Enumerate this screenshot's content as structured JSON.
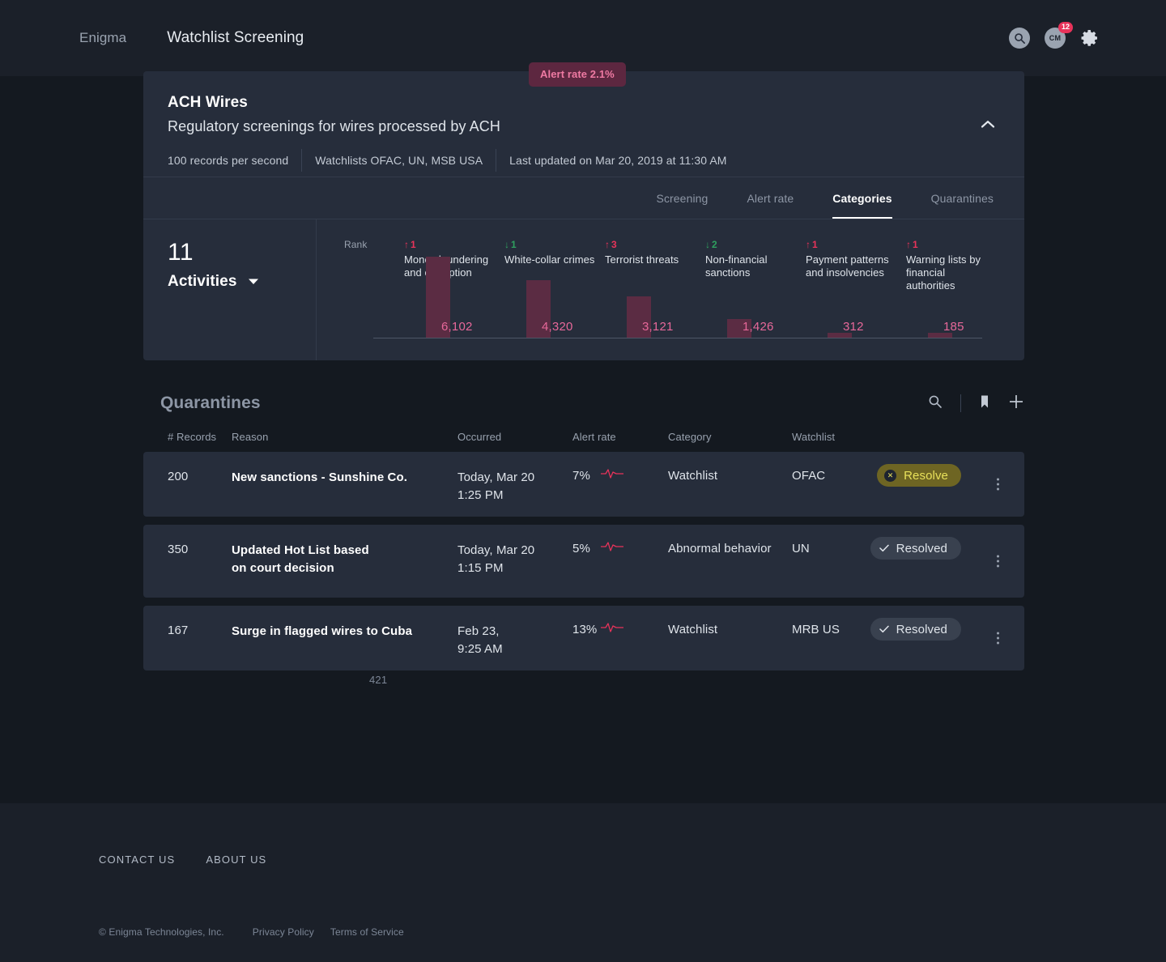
{
  "nav": {
    "brand": "Enigma",
    "title": "Watchlist Screening",
    "search_icon": "search-icon",
    "avatar_initials": "CM",
    "badge_count": "12",
    "gear_icon": "gear-icon"
  },
  "alert_pill": {
    "label": "Alert rate 2.1%"
  },
  "card": {
    "title": "ACH Wires",
    "subtitle": "Regulatory screenings for wires processed by ACH",
    "collapse_icon": "chevron-up-icon",
    "meta": [
      "100 records per second",
      "Watchlists OFAC, UN, MSB USA",
      "Last updated on Mar 20, 2019 at 11:30 AM"
    ],
    "tabs": [
      {
        "label": "Screening",
        "active": false
      },
      {
        "label": "Alert rate",
        "active": false
      },
      {
        "label": "Categories",
        "active": true
      },
      {
        "label": "Quarantines",
        "active": false
      }
    ],
    "summary": {
      "count": "11",
      "label": "Activities",
      "caret_icon": "caret-down-icon"
    }
  },
  "chart_data": {
    "type": "bar",
    "title": "Categories",
    "rank_label": "Rank",
    "xlabel": "",
    "ylabel": "",
    "ylim": [
      0,
      6102
    ],
    "grid": false,
    "legend": "none",
    "categories": [
      "Money laundering and corruption",
      "White-collar crimes",
      "Terrorist threats",
      "Non-financial sanctions",
      "Payment patterns and insolvencies",
      "Warning lists by financial authorities"
    ],
    "values": [
      6102,
      4320,
      3121,
      1426,
      312,
      185
    ],
    "value_labels": [
      "6,102",
      "4,320",
      "3,121",
      "1,426",
      "312",
      "185"
    ],
    "rank_deltas": [
      {
        "direction": "up",
        "value": "1"
      },
      {
        "direction": "down",
        "value": "1"
      },
      {
        "direction": "up",
        "value": "3"
      },
      {
        "direction": "down",
        "value": "2"
      },
      {
        "direction": "up",
        "value": "1"
      },
      {
        "direction": "up",
        "value": "1"
      }
    ],
    "bar_color": "#5b2c43",
    "label_color": "#e8689a",
    "up_color": "#e8335a",
    "down_color": "#2fa05f"
  },
  "quarantines": {
    "title": "Quarantines",
    "actions": {
      "search_icon": "search-icon",
      "bookmark_icon": "bookmark-icon",
      "add_icon": "plus-icon"
    },
    "columns": [
      "# Records",
      "Reason",
      "Occurred",
      "Alert rate",
      "Category",
      "Watchlist"
    ],
    "rows": [
      {
        "records": "200",
        "reason": "New sanctions - Sunshine Co.",
        "occurred": "Today, Mar 20\n1:25 PM",
        "alert_rate": "7%",
        "category": "Watchlist",
        "watchlist": "OFAC",
        "status": "Resolve",
        "status_type": "resolve",
        "status_icon": "x-circle-icon"
      },
      {
        "records": "350",
        "reason": "Updated Hot List based\non court decision",
        "occurred": "Today, Mar 20\n1:15 PM",
        "alert_rate": "5%",
        "category": "Abnormal behavior",
        "watchlist": "UN",
        "status": "Resolved",
        "status_type": "resolved",
        "status_icon": "check-icon"
      },
      {
        "records": "167",
        "reason": "Surge in flagged wires to Cuba",
        "occurred": "Feb 23,\n9:25 AM",
        "alert_rate": "13%",
        "category": "Watchlist",
        "watchlist": "MRB US",
        "status": "Resolved",
        "status_type": "resolved",
        "status_icon": "check-icon"
      }
    ],
    "footer_count": "421"
  },
  "footer": {
    "links": [
      "CONTACT US",
      "ABOUT US"
    ],
    "copyright": "© Enigma Technologies, Inc.",
    "privacy": "Privacy Policy",
    "terms": "Terms of Service"
  }
}
